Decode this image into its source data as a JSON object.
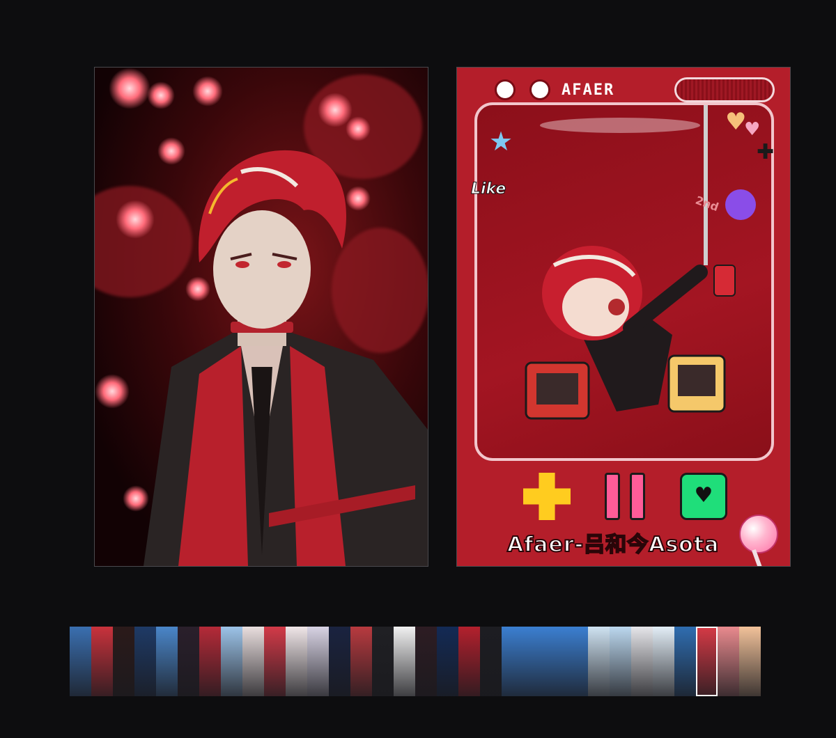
{
  "gallery": {
    "left_image": {
      "alt": ""
    },
    "right_card": {
      "brand_text": "AFAER",
      "nameplate": "Afaer-吕和今Asota",
      "sticker_like": "Like",
      "sticker_2nd": "2nd",
      "heart_glyph": "♥",
      "colors": {
        "card_red": "#b41e2a",
        "plus_yellow": "#ffcc1f",
        "pause_pink": "#ff5c98",
        "heart_green": "#1fde7a"
      }
    },
    "thumbnails": {
      "count": 32,
      "selected_index": 29,
      "colors": [
        "#3a6fb0",
        "#c9323c",
        "#2b1a1a",
        "#1e3a66",
        "#4a86c9",
        "#2a1f2b",
        "#b52a38",
        "#9cc3e8",
        "#e9dede",
        "#d23a48",
        "#f0e6e8",
        "#d8d3e4",
        "#1a2340",
        "#b83a3f",
        "#202024",
        "#f1f1f1",
        "#2d1c23",
        "#132a55",
        "#b3202d",
        "#1d1d22",
        "#3b7fd1",
        "#3b7fd1",
        "#3b7fd1",
        "#3b7fd1",
        "#cfe3f2",
        "#bcd8ef",
        "#e6e6ea",
        "#e3eef7",
        "#2f6db0",
        "#d63a46",
        "#e98a8e",
        "#f2c29a"
      ]
    }
  }
}
